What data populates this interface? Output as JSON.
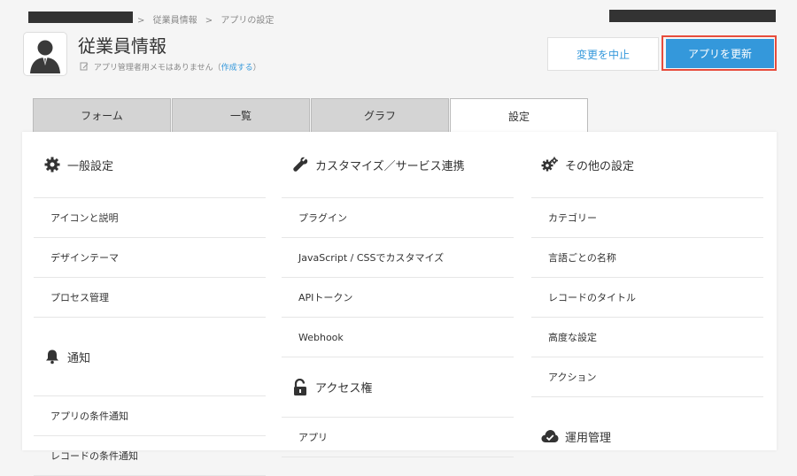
{
  "breadcrumb": {
    "sep": ">",
    "items": [
      "従業員情報",
      "アプリの設定"
    ]
  },
  "app": {
    "title": "従業員情報",
    "memo_text": "アプリ管理者用メモはありません（",
    "memo_link": "作成する",
    "memo_close": "）"
  },
  "actions": {
    "cancel": "変更を中止",
    "update": "アプリを更新"
  },
  "tabs": [
    {
      "label": "フォーム",
      "active": false
    },
    {
      "label": "一覧",
      "active": false
    },
    {
      "label": "グラフ",
      "active": false
    },
    {
      "label": "設定",
      "active": true
    }
  ],
  "columns": [
    {
      "sections": [
        {
          "icon": "gear-icon",
          "title": "一般設定",
          "items": [
            "アイコンと説明",
            "デザインテーマ",
            "プロセス管理"
          ]
        },
        {
          "icon": "bell-icon",
          "title": "通知",
          "items": [
            "アプリの条件通知",
            "レコードの条件通知"
          ]
        }
      ]
    },
    {
      "sections": [
        {
          "icon": "wrench-icon",
          "title": "カスタマイズ／サービス連携",
          "items": [
            "プラグイン",
            "JavaScript / CSSでカスタマイズ",
            "APIトークン",
            "Webhook"
          ]
        },
        {
          "icon": "unlock-icon",
          "title": "アクセス権",
          "items": [
            "アプリ"
          ]
        }
      ]
    },
    {
      "sections": [
        {
          "icon": "gears-icon",
          "title": "その他の設定",
          "items": [
            "カテゴリー",
            "言語ごとの名称",
            "レコードのタイトル",
            "高度な設定",
            "アクション"
          ]
        },
        {
          "icon": "cloud-check-icon",
          "title": "運用管理",
          "items": []
        }
      ]
    }
  ],
  "colors": {
    "accent": "#3498db",
    "highlight": "#e74c3c"
  }
}
